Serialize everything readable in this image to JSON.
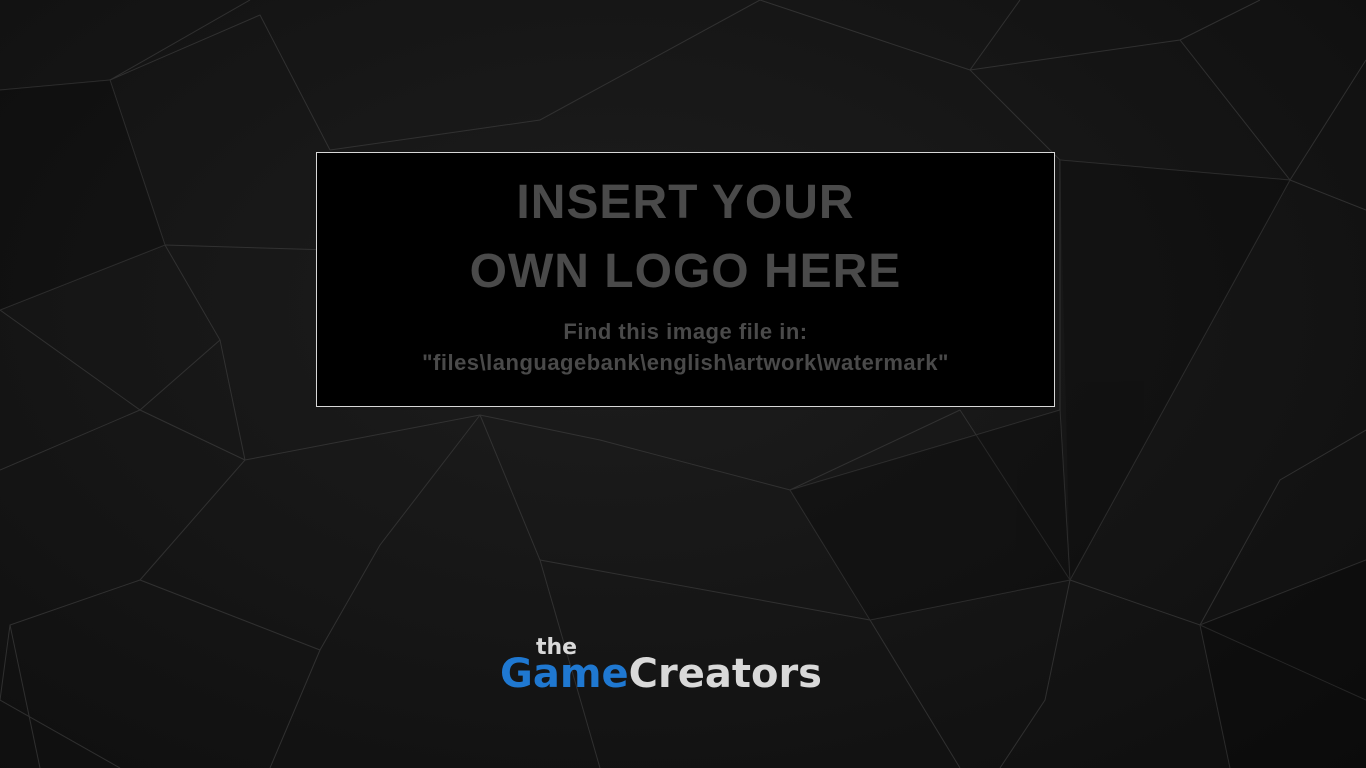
{
  "watermark": {
    "heading_line1": "INSERT YOUR",
    "heading_line2": "OWN LOGO HERE",
    "info_line1": "Find this image file in:",
    "info_line2": "\"files\\languagebank\\english\\artwork\\watermark\""
  },
  "brand": {
    "prefix": "the",
    "name_part1": "Game",
    "name_part2": "Creators",
    "color_part1": "#1f78d1",
    "color_part2": "#d9d9d9"
  },
  "colors": {
    "background": "#141414",
    "panel": "#000000",
    "panel_border": "#d8d8d8",
    "placeholder_text": "#4a4a4a"
  }
}
